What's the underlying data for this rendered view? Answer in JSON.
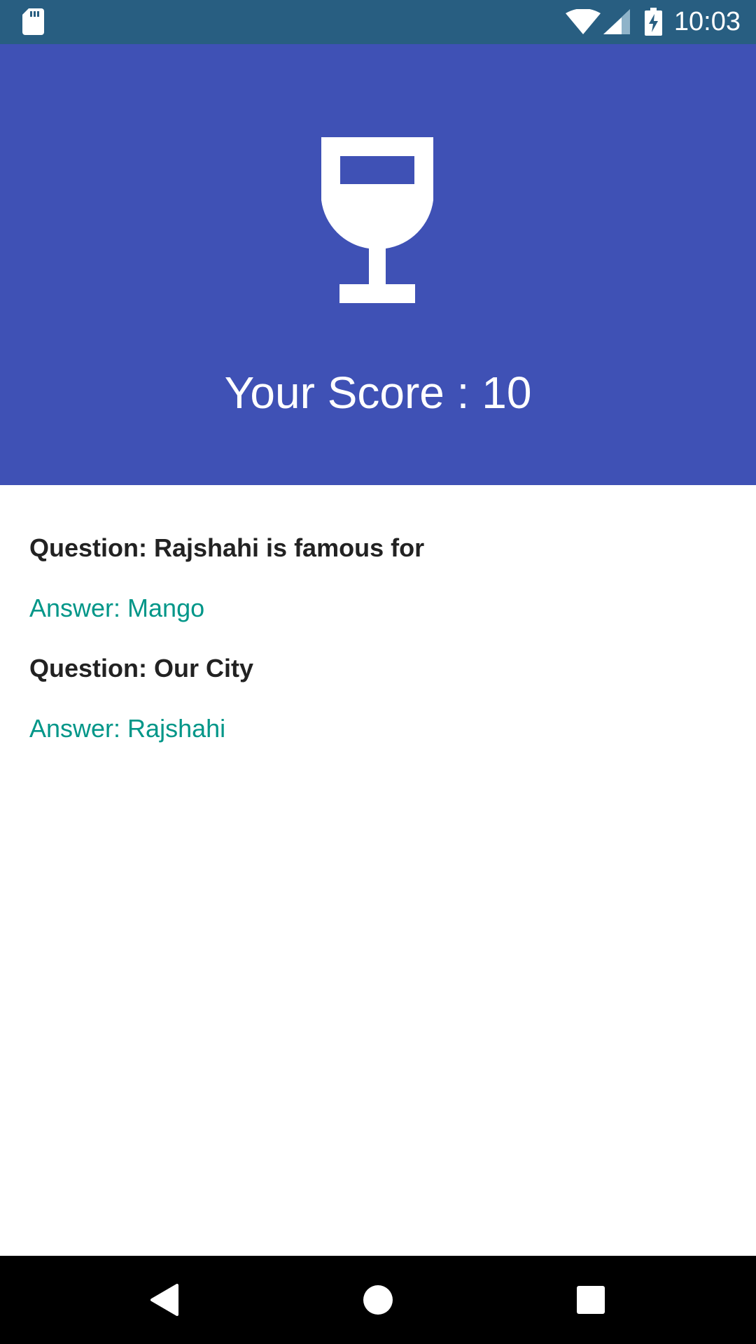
{
  "status_bar": {
    "time": "10:03",
    "icons": [
      "sd-card-icon",
      "wifi-icon",
      "cell-signal-icon",
      "battery-charging-icon"
    ]
  },
  "header": {
    "icon": "wine-glass-icon",
    "score_text": "Your Score : 10",
    "background": "#3f51b5"
  },
  "results": [
    {
      "question": "Question: Rajshahi is famous for",
      "answer": "Answer: Mango"
    },
    {
      "question": "Question: Our City",
      "answer": "Answer: Rajshahi"
    }
  ],
  "colors": {
    "status_bar": "#285e81",
    "answer_text": "#009688",
    "question_text": "#222222"
  },
  "nav_bar": {
    "buttons": [
      "back-icon",
      "home-icon",
      "recents-icon"
    ]
  }
}
